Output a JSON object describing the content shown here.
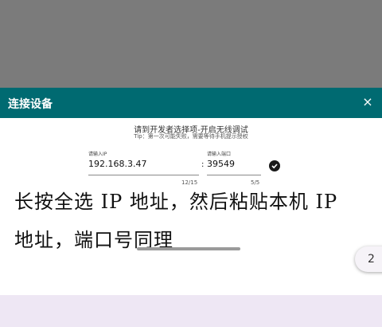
{
  "dialog": {
    "title": "连接设备",
    "close_icon": "×"
  },
  "hints": {
    "title": "请到开发者选择项-开启无线调试",
    "tip": "Tip：第一次可能失败，需要等待手机提示授权"
  },
  "ip_field": {
    "label": "请输入IP",
    "value": "192.168.3.47",
    "counter": "12/15"
  },
  "separator": ":",
  "port_field": {
    "label": "请输入端口",
    "value": "39549",
    "counter": "5/5"
  },
  "overlay": {
    "line1": "长按全选 IP 地址，然后粘贴本机 IP",
    "line2": "地址，端口号同理"
  },
  "page_indicator": "2",
  "colors": {
    "header": "#006a71",
    "dim": "#7b7b7b",
    "bottom_strip": "#eee7f4"
  },
  "icons": {
    "confirm": "check-circle-icon",
    "close": "close-icon"
  }
}
